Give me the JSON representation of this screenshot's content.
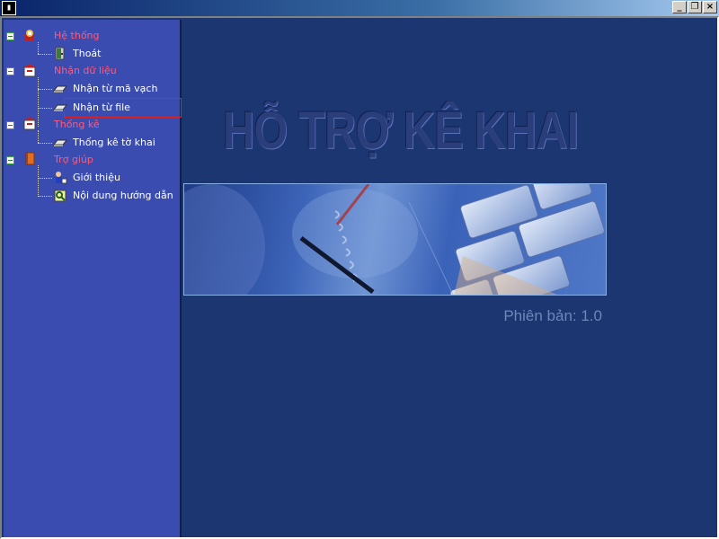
{
  "window": {
    "icon": "app-icon",
    "buttons": [
      "minimize",
      "restore",
      "close"
    ],
    "title_gradient": [
      "#0a246a",
      "#a6caf0"
    ]
  },
  "tree": {
    "categories": [
      {
        "label": "Hệ thống",
        "icon": "system-icon",
        "items": [
          {
            "label": "Thoát",
            "icon": "exit-door-icon"
          }
        ]
      },
      {
        "label": "Nhận dữ liệu",
        "icon": "receive-data-icon",
        "items": [
          {
            "label": "Nhận từ mã vạch",
            "icon": "tray-icon"
          },
          {
            "label": "Nhận từ file",
            "icon": "tray-icon",
            "selected": true
          }
        ]
      },
      {
        "label": "Thống kê",
        "icon": "statistics-icon",
        "items": [
          {
            "label": "Thống kê tờ khai",
            "icon": "tray-icon"
          }
        ]
      },
      {
        "label": "Trợ giúp",
        "icon": "help-book-icon",
        "items": [
          {
            "label": "Giới thiệu",
            "icon": "about-icon"
          },
          {
            "label": "Nội dung hướng dẫn",
            "icon": "guide-icon"
          }
        ]
      }
    ]
  },
  "main": {
    "title": "HỖ TRỢ KÊ KHAI",
    "version": "Phiên bản: 1.0"
  },
  "colors": {
    "background": "#1c3672",
    "tree_background": "#3a4cb0",
    "category_text": "#ff5a7a",
    "item_text": "#ffffff",
    "selection_border": "#e02020"
  }
}
